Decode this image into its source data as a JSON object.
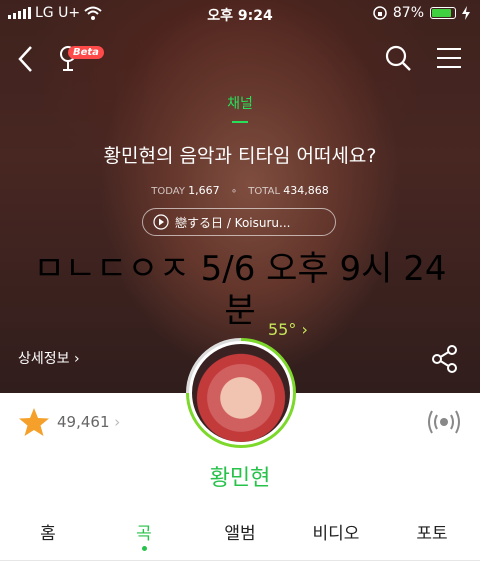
{
  "status_bar": {
    "carrier": "LG U+",
    "time": "오후 9:24",
    "battery_percent": "87%",
    "battery_level": 0.87
  },
  "nav": {
    "beta_badge": "Beta"
  },
  "channel": {
    "label": "채널",
    "title": "황민현의 음악과 티타임 어떠세요?",
    "today_label": "TODAY",
    "today_value": "1,667",
    "total_label": "TOTAL",
    "total_value": "434,868",
    "now_playing": "戀する日 / Koisuru..."
  },
  "overlay": {
    "text": "ㅁㄴㄷㅇㅈ 5/6 오후 9시 24분",
    "temperature": "55°"
  },
  "detail_link": "상세정보",
  "likes_count": "49,461",
  "artist_name": "황민현",
  "tabs": [
    {
      "label": "홈",
      "active": false
    },
    {
      "label": "곡",
      "active": true
    },
    {
      "label": "앨범",
      "active": false
    },
    {
      "label": "비디오",
      "active": false
    },
    {
      "label": "포토",
      "active": false
    }
  ],
  "colors": {
    "accent_green": "#27c24a",
    "beta_red": "#ff4a4a",
    "star_orange": "#f5a02a"
  }
}
